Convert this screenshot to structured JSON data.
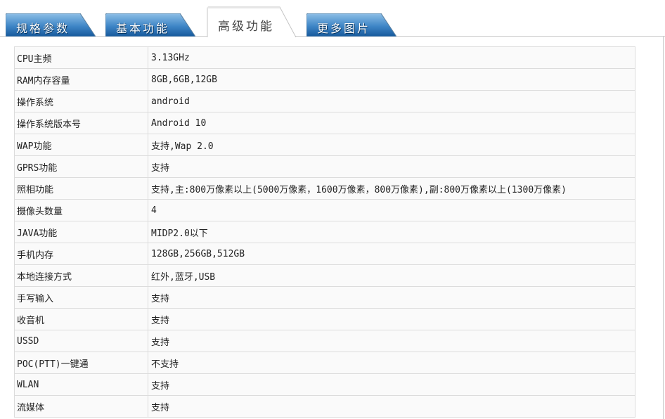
{
  "tabs": [
    {
      "label": "规格参数",
      "active": false
    },
    {
      "label": "基本功能",
      "active": false
    },
    {
      "label": "高级功能",
      "active": true
    },
    {
      "label": "更多图片",
      "active": false
    }
  ],
  "colors": {
    "tab_inactive_top": "#7fb3df",
    "tab_inactive_bottom": "#1d63a8",
    "tab_active_bg": "#ffffff",
    "table_border": "#dcdcdc",
    "table_bg": "#fafafa"
  },
  "specs": [
    {
      "key": "CPU主频",
      "value": "3.13GHz"
    },
    {
      "key": "RAM内存容量",
      "value": "8GB,6GB,12GB"
    },
    {
      "key": "操作系统",
      "value": "android"
    },
    {
      "key": "操作系统版本号",
      "value": "Android 10"
    },
    {
      "key": "WAP功能",
      "value": "支持,Wap 2.0"
    },
    {
      "key": "GPRS功能",
      "value": "支持"
    },
    {
      "key": "照相功能",
      "value": "支持,主:800万像素以上(5000万像素，1600万像素，800万像素),副:800万像素以上(1300万像素)"
    },
    {
      "key": "摄像头数量",
      "value": "4"
    },
    {
      "key": "JAVA功能",
      "value": "MIDP2.0以下"
    },
    {
      "key": "手机内存",
      "value": "128GB,256GB,512GB"
    },
    {
      "key": "本地连接方式",
      "value": "红外,蓝牙,USB"
    },
    {
      "key": "手写输入",
      "value": "支持"
    },
    {
      "key": "收音机",
      "value": "支持"
    },
    {
      "key": "USSD",
      "value": "支持"
    },
    {
      "key": "POC(PTT)一键通",
      "value": "不支持"
    },
    {
      "key": "WLAN",
      "value": "支持"
    },
    {
      "key": "流媒体",
      "value": "支持"
    }
  ]
}
